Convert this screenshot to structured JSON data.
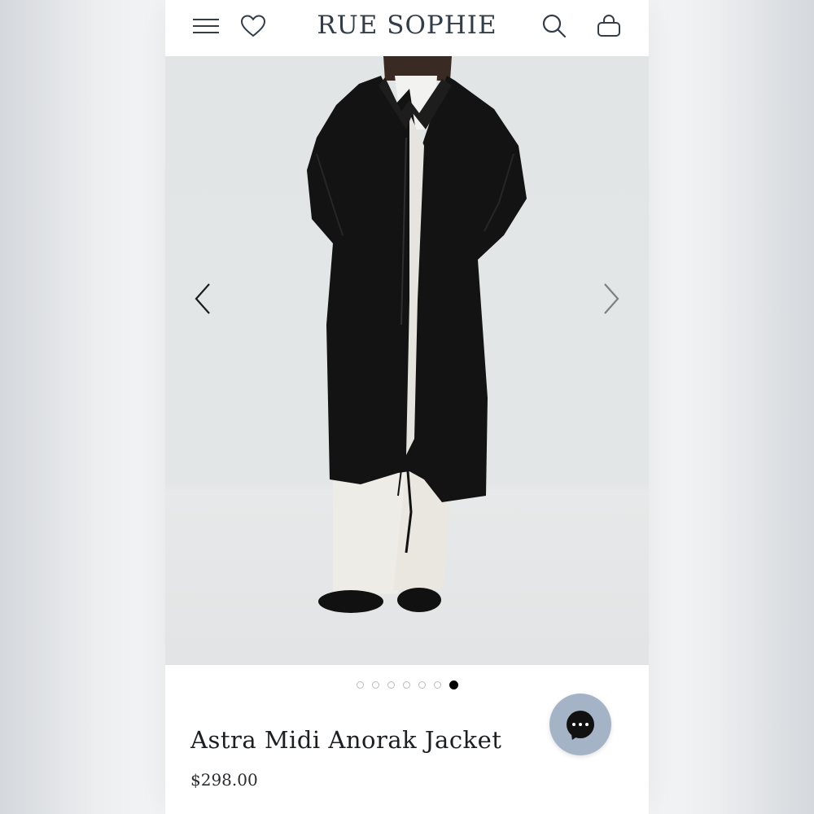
{
  "header": {
    "brand": "RUE SOPHIE",
    "icons": [
      "hamburger-menu-icon",
      "heart-icon",
      "search-icon",
      "shopping-bag-icon"
    ]
  },
  "gallery": {
    "image_alt": "Model wearing a black midi anorak jacket with white trousers and black shoes",
    "slide_count": 7,
    "active_slide": 7
  },
  "product": {
    "name": "Astra Midi Anorak Jacket",
    "price": "$298.00"
  },
  "colors": {
    "brand_text": "#333d47",
    "chat_button": "#a4b4c6",
    "active_dot": "#000000"
  }
}
